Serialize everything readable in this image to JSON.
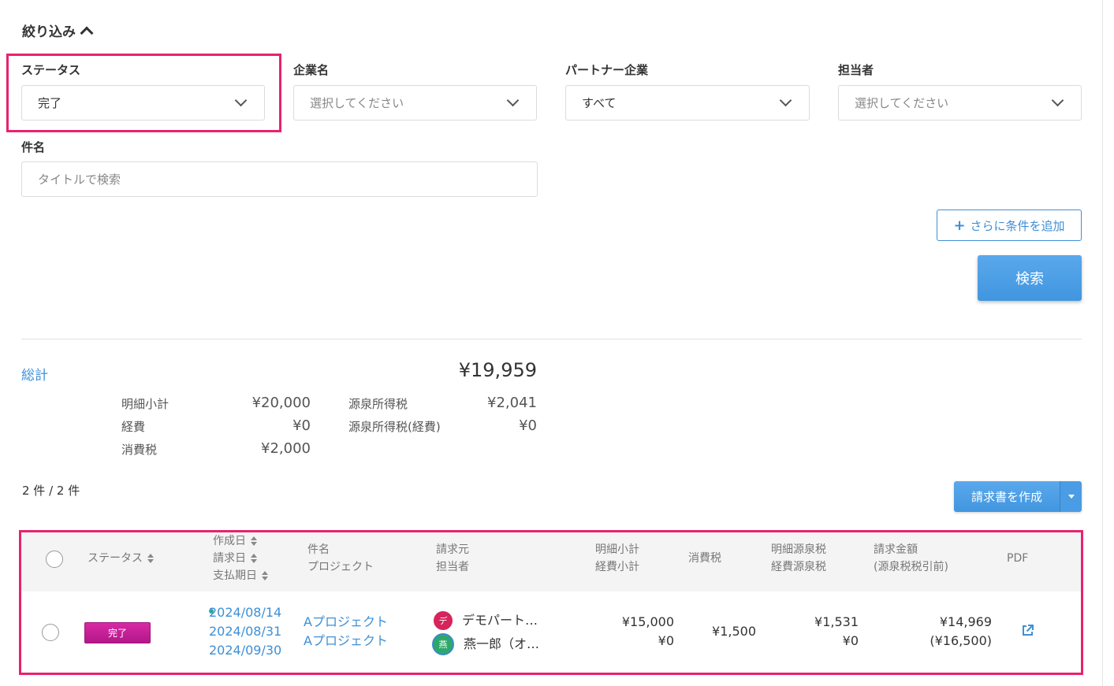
{
  "filter": {
    "title": "絞り込み",
    "status": {
      "label": "ステータス",
      "value": "完了"
    },
    "company": {
      "label": "企業名",
      "placeholder": "選択してください"
    },
    "partner": {
      "label": "パートナー企業",
      "value": "すべて"
    },
    "assignee": {
      "label": "担当者",
      "placeholder": "選択してください"
    },
    "subject": {
      "label": "件名",
      "placeholder": "タイトルで検索"
    },
    "add_condition_label": "さらに条件を追加",
    "search_label": "検索"
  },
  "totals": {
    "label": "総計",
    "amount": "¥19,959",
    "items": [
      {
        "label": "明細小計",
        "value": "¥20,000"
      },
      {
        "label": "経費",
        "value": "¥0"
      },
      {
        "label": "消費税",
        "value": "¥2,000"
      },
      {
        "label": "源泉所得税",
        "value": "¥2,041"
      },
      {
        "label": "源泉所得税(経費)",
        "value": "¥0"
      }
    ]
  },
  "count_text": "2 件 / 2 件",
  "create_invoice_label": "請求書を作成",
  "table": {
    "headers": {
      "status": "ステータス",
      "dates": [
        "作成日",
        "請求日",
        "支払期日"
      ],
      "subject": [
        "件名",
        "プロジェクト"
      ],
      "issuer": [
        "請求元",
        "担当者"
      ],
      "subtotal": [
        "明細小計",
        "経費小計"
      ],
      "tax": "消費税",
      "withholding": [
        "明細源泉税",
        "経費源泉税"
      ],
      "amount": [
        "請求金額",
        "(源泉税税引前)"
      ],
      "pdf": "PDF"
    },
    "rows": [
      {
        "status": "完了",
        "status_color": "#c21f97",
        "dates": [
          "2024/08/14",
          "2024/08/31",
          "2024/09/30"
        ],
        "subject": "Aプロジェクト",
        "project": "Aプロジェクト",
        "issuer": {
          "initial": "デ",
          "name": "デモパート…",
          "color": "#d6245c"
        },
        "assignee": {
          "initial": "燕",
          "name": "燕一郎（オ…",
          "color": "#2ea86a"
        },
        "subtotal": "¥15,000",
        "expense_subtotal": "¥0",
        "tax": "¥1,500",
        "withholding": "¥1,531",
        "expense_withholding": "¥0",
        "amount": "¥14,969",
        "amount_before": "(¥16,500)",
        "pdf_icon": "external-link-icon"
      }
    ]
  },
  "colors": {
    "accent": "#3e8fd6",
    "highlight": "#e8226e",
    "badge": "#c21f97"
  }
}
